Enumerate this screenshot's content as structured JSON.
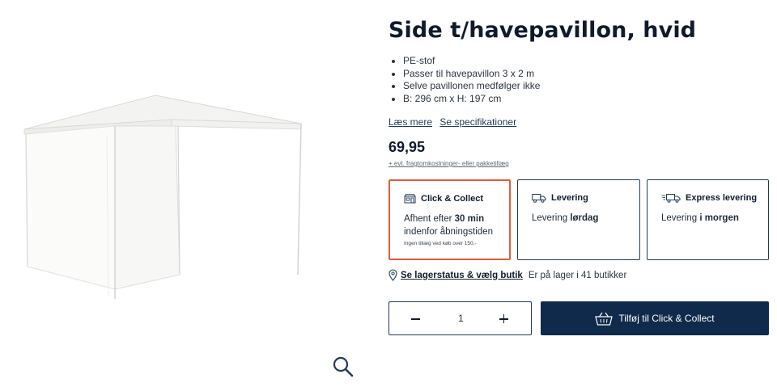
{
  "product": {
    "title": "Side t/havepavillon, hvid",
    "features": [
      "PE-stof",
      "Passer til havepavillon 3 x 2 m",
      "Selve pavillonen medfølger ikke",
      "B: 296 cm x H: 197 cm"
    ],
    "links": {
      "read_more": "Læs mere",
      "specs": "Se specifikationer"
    },
    "price": "69,95",
    "fee_note": "+ evt. fragtomkostninger- eller pakketillæg"
  },
  "delivery_options": [
    {
      "title": "Click & Collect",
      "line1_prefix": "Afhent efter ",
      "line1_bold": "30 min",
      "line2": "indenfor åbningstiden",
      "note": "Ingen tillæg ved køb over 150,-",
      "selected": true,
      "icon": "store-icon"
    },
    {
      "title": "Levering",
      "line1_prefix": "Levering ",
      "line1_bold": "lørdag",
      "selected": false,
      "icon": "truck-icon"
    },
    {
      "title": "Express levering",
      "line1_prefix": "Levering ",
      "line1_bold": "i morgen",
      "selected": false,
      "icon": "express-truck-icon"
    }
  ],
  "stock": {
    "link": "Se lagerstatus & vælg butik",
    "text": "Er på lager i 41 butikker"
  },
  "quantity": {
    "value": "1"
  },
  "cta": {
    "label": "Tilføj til Click & Collect",
    "icon": "basket-icon"
  },
  "colors": {
    "navy": "#0f2a4a",
    "selected_border": "#e35c3c",
    "border": "#1f3b5c"
  },
  "gallery": {
    "zoom_icon": "magnifier-icon"
  }
}
